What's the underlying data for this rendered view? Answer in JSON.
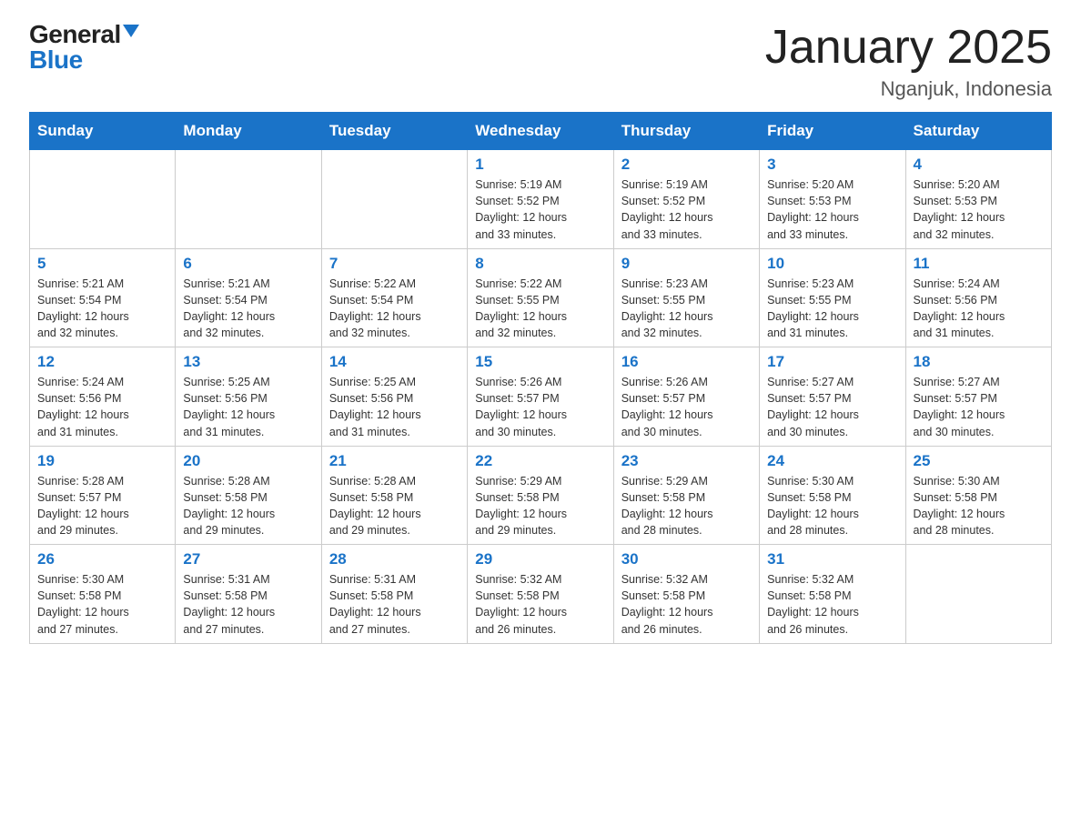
{
  "logo": {
    "general": "General",
    "blue": "Blue"
  },
  "title": "January 2025",
  "subtitle": "Nganjuk, Indonesia",
  "days_of_week": [
    "Sunday",
    "Monday",
    "Tuesday",
    "Wednesday",
    "Thursday",
    "Friday",
    "Saturday"
  ],
  "weeks": [
    [
      {
        "day": "",
        "info": ""
      },
      {
        "day": "",
        "info": ""
      },
      {
        "day": "",
        "info": ""
      },
      {
        "day": "1",
        "info": "Sunrise: 5:19 AM\nSunset: 5:52 PM\nDaylight: 12 hours\nand 33 minutes."
      },
      {
        "day": "2",
        "info": "Sunrise: 5:19 AM\nSunset: 5:52 PM\nDaylight: 12 hours\nand 33 minutes."
      },
      {
        "day": "3",
        "info": "Sunrise: 5:20 AM\nSunset: 5:53 PM\nDaylight: 12 hours\nand 33 minutes."
      },
      {
        "day": "4",
        "info": "Sunrise: 5:20 AM\nSunset: 5:53 PM\nDaylight: 12 hours\nand 32 minutes."
      }
    ],
    [
      {
        "day": "5",
        "info": "Sunrise: 5:21 AM\nSunset: 5:54 PM\nDaylight: 12 hours\nand 32 minutes."
      },
      {
        "day": "6",
        "info": "Sunrise: 5:21 AM\nSunset: 5:54 PM\nDaylight: 12 hours\nand 32 minutes."
      },
      {
        "day": "7",
        "info": "Sunrise: 5:22 AM\nSunset: 5:54 PM\nDaylight: 12 hours\nand 32 minutes."
      },
      {
        "day": "8",
        "info": "Sunrise: 5:22 AM\nSunset: 5:55 PM\nDaylight: 12 hours\nand 32 minutes."
      },
      {
        "day": "9",
        "info": "Sunrise: 5:23 AM\nSunset: 5:55 PM\nDaylight: 12 hours\nand 32 minutes."
      },
      {
        "day": "10",
        "info": "Sunrise: 5:23 AM\nSunset: 5:55 PM\nDaylight: 12 hours\nand 31 minutes."
      },
      {
        "day": "11",
        "info": "Sunrise: 5:24 AM\nSunset: 5:56 PM\nDaylight: 12 hours\nand 31 minutes."
      }
    ],
    [
      {
        "day": "12",
        "info": "Sunrise: 5:24 AM\nSunset: 5:56 PM\nDaylight: 12 hours\nand 31 minutes."
      },
      {
        "day": "13",
        "info": "Sunrise: 5:25 AM\nSunset: 5:56 PM\nDaylight: 12 hours\nand 31 minutes."
      },
      {
        "day": "14",
        "info": "Sunrise: 5:25 AM\nSunset: 5:56 PM\nDaylight: 12 hours\nand 31 minutes."
      },
      {
        "day": "15",
        "info": "Sunrise: 5:26 AM\nSunset: 5:57 PM\nDaylight: 12 hours\nand 30 minutes."
      },
      {
        "day": "16",
        "info": "Sunrise: 5:26 AM\nSunset: 5:57 PM\nDaylight: 12 hours\nand 30 minutes."
      },
      {
        "day": "17",
        "info": "Sunrise: 5:27 AM\nSunset: 5:57 PM\nDaylight: 12 hours\nand 30 minutes."
      },
      {
        "day": "18",
        "info": "Sunrise: 5:27 AM\nSunset: 5:57 PM\nDaylight: 12 hours\nand 30 minutes."
      }
    ],
    [
      {
        "day": "19",
        "info": "Sunrise: 5:28 AM\nSunset: 5:57 PM\nDaylight: 12 hours\nand 29 minutes."
      },
      {
        "day": "20",
        "info": "Sunrise: 5:28 AM\nSunset: 5:58 PM\nDaylight: 12 hours\nand 29 minutes."
      },
      {
        "day": "21",
        "info": "Sunrise: 5:28 AM\nSunset: 5:58 PM\nDaylight: 12 hours\nand 29 minutes."
      },
      {
        "day": "22",
        "info": "Sunrise: 5:29 AM\nSunset: 5:58 PM\nDaylight: 12 hours\nand 29 minutes."
      },
      {
        "day": "23",
        "info": "Sunrise: 5:29 AM\nSunset: 5:58 PM\nDaylight: 12 hours\nand 28 minutes."
      },
      {
        "day": "24",
        "info": "Sunrise: 5:30 AM\nSunset: 5:58 PM\nDaylight: 12 hours\nand 28 minutes."
      },
      {
        "day": "25",
        "info": "Sunrise: 5:30 AM\nSunset: 5:58 PM\nDaylight: 12 hours\nand 28 minutes."
      }
    ],
    [
      {
        "day": "26",
        "info": "Sunrise: 5:30 AM\nSunset: 5:58 PM\nDaylight: 12 hours\nand 27 minutes."
      },
      {
        "day": "27",
        "info": "Sunrise: 5:31 AM\nSunset: 5:58 PM\nDaylight: 12 hours\nand 27 minutes."
      },
      {
        "day": "28",
        "info": "Sunrise: 5:31 AM\nSunset: 5:58 PM\nDaylight: 12 hours\nand 27 minutes."
      },
      {
        "day": "29",
        "info": "Sunrise: 5:32 AM\nSunset: 5:58 PM\nDaylight: 12 hours\nand 26 minutes."
      },
      {
        "day": "30",
        "info": "Sunrise: 5:32 AM\nSunset: 5:58 PM\nDaylight: 12 hours\nand 26 minutes."
      },
      {
        "day": "31",
        "info": "Sunrise: 5:32 AM\nSunset: 5:58 PM\nDaylight: 12 hours\nand 26 minutes."
      },
      {
        "day": "",
        "info": ""
      }
    ]
  ]
}
